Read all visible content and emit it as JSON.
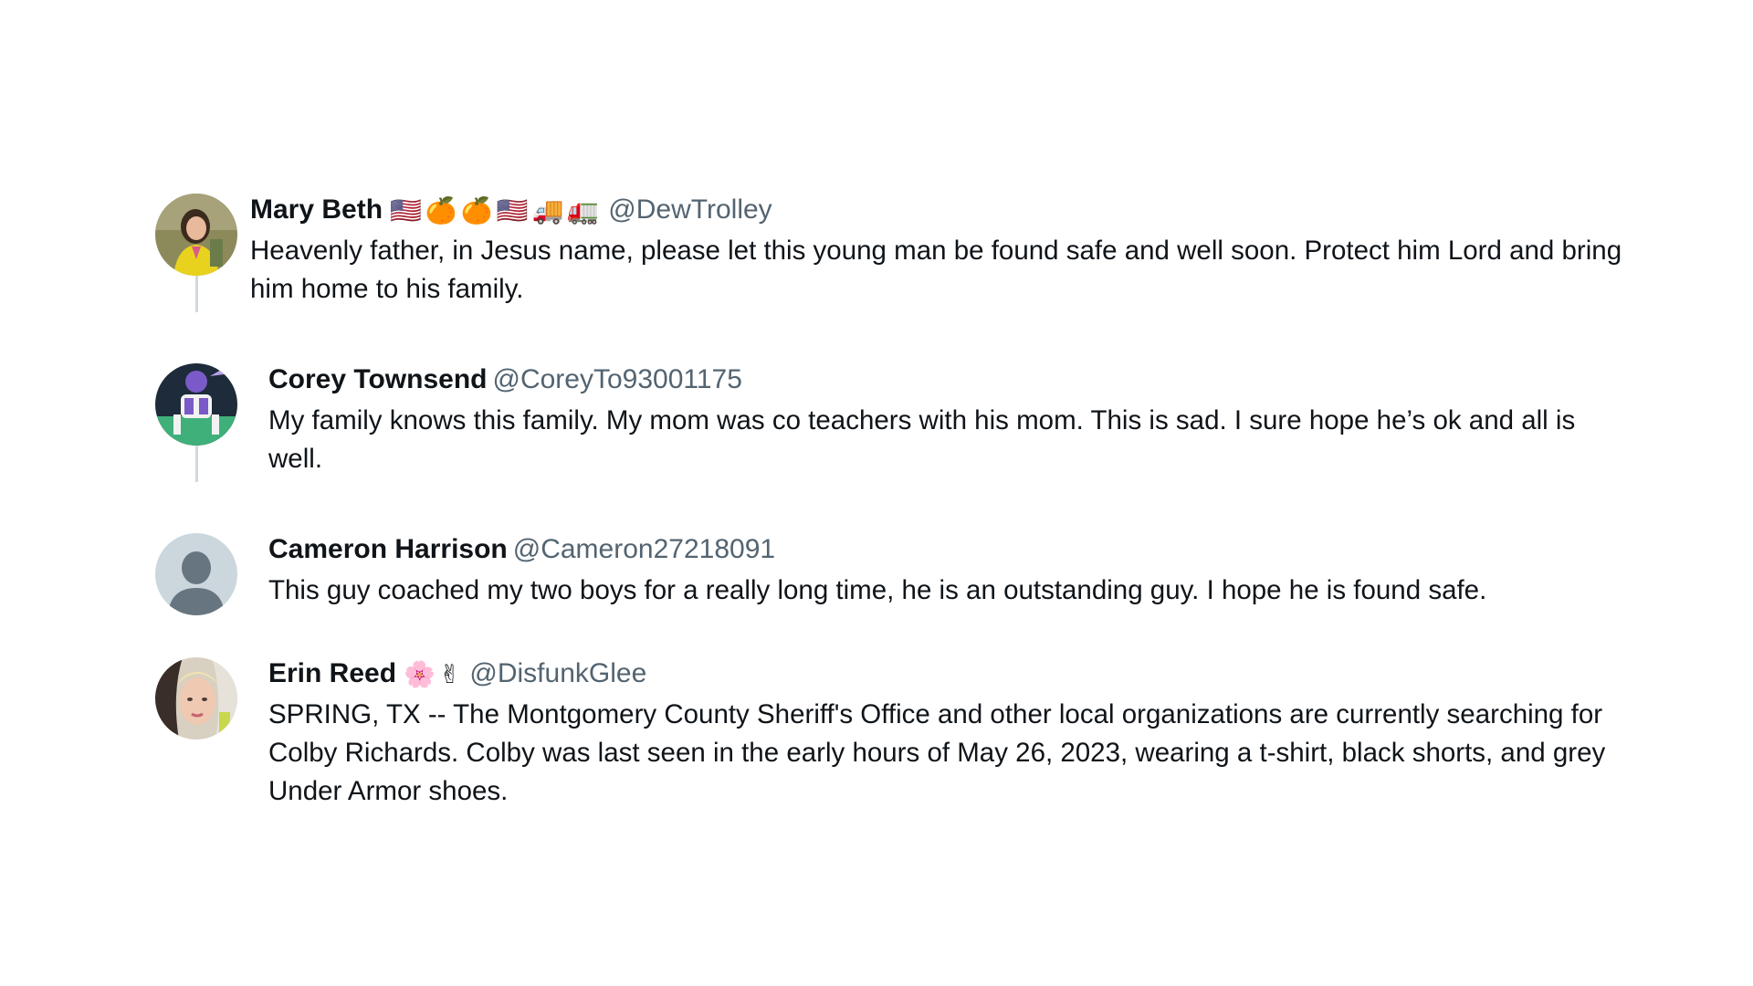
{
  "tweets": [
    {
      "name": "Mary Beth",
      "emojis": [
        "🇺🇸",
        "🍊",
        "🍊",
        "🇺🇸",
        "🚚",
        "🚛"
      ],
      "handle": "@DewTrolley",
      "text": "Heavenly father, in Jesus name, please let this young man be found safe and well soon. Protect him Lord and bring him home to his family."
    },
    {
      "name": "Corey Townsend",
      "emojis": [],
      "handle": "@CoreyTo93001175",
      "text": "My family knows this family. My mom was co teachers with his mom. This is sad. I sure hope he’s ok and all is well."
    },
    {
      "name": "Cameron Harrison",
      "emojis": [],
      "handle": "@Cameron27218091",
      "text": "This guy coached my two boys for a really long time, he is an outstanding guy. I hope he is found safe."
    },
    {
      "name": "Erin Reed",
      "emojis": [
        "🌸",
        "✌"
      ],
      "handle": "@DisfunkGlee",
      "text": "SPRING, TX -- The Montgomery County Sheriff's Office and other local organizations are currently searching for Colby Richards. Colby was last seen in the early hours of May 26, 2023, wearing a t-shirt, black shorts, and grey Under Armor shoes."
    }
  ],
  "colors": {
    "text": "#0f1419",
    "handle": "#536471",
    "thread_line": "#cfd9de"
  }
}
